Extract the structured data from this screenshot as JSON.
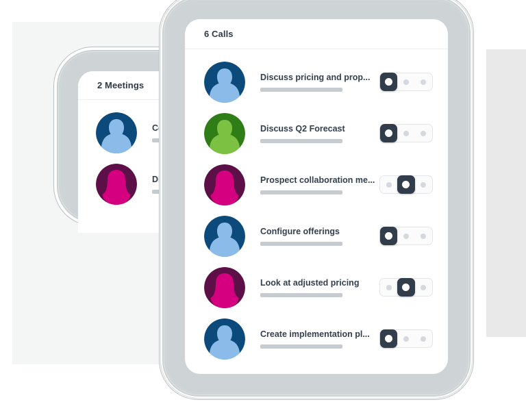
{
  "background": {
    "left_panel_color": "#f4f5f5",
    "right_panel_color": "#e9e9e9"
  },
  "back_card": {
    "header_title": "2 Meetings",
    "rows": [
      {
        "title": "Collabora",
        "avatar": "avatar-male-blue",
        "avatar_bg": "#0b4a7a",
        "avatar_fg": "#8bbbe8",
        "subtitle_placeholder": true
      },
      {
        "title": "Discuss",
        "avatar": "avatar-female-magenta",
        "avatar_bg": "#5d0f47",
        "avatar_fg": "#d4007f",
        "subtitle_placeholder": true
      }
    ]
  },
  "front_card": {
    "header_title": "6 Calls",
    "rows": [
      {
        "title": "Discuss pricing and prop...",
        "avatar": "avatar-male-blue",
        "avatar_bg": "#0b4a7a",
        "avatar_fg": "#8bbbe8",
        "toggle_position": 0,
        "toggle_positions": 3
      },
      {
        "title": "Discuss Q2 Forecast",
        "avatar": "avatar-male-green",
        "avatar_bg": "#2f7d16",
        "avatar_fg": "#7cc142",
        "toggle_position": 0,
        "toggle_positions": 3
      },
      {
        "title": "Prospect collaboration me...",
        "avatar": "avatar-female-magenta",
        "avatar_bg": "#5d0f47",
        "avatar_fg": "#d4007f",
        "toggle_position": 1,
        "toggle_positions": 3
      },
      {
        "title": "Configure offerings",
        "avatar": "avatar-male-blue",
        "avatar_bg": "#0b4a7a",
        "avatar_fg": "#8bbbe8",
        "toggle_position": 0,
        "toggle_positions": 3
      },
      {
        "title": "Look at adjusted pricing",
        "avatar": "avatar-female-magenta",
        "avatar_bg": "#5d0f47",
        "avatar_fg": "#d4007f",
        "toggle_position": 1,
        "toggle_positions": 3
      },
      {
        "title": "Create implementation pl...",
        "avatar": "avatar-male-blue",
        "avatar_bg": "#0b4a7a",
        "avatar_fg": "#8bbbe8",
        "toggle_position": 0,
        "toggle_positions": 3
      }
    ]
  },
  "colors": {
    "toggle_active": "#313d4a",
    "toggle_track": "#fbfbfc",
    "toggle_dot": "#d5d8dc",
    "title_text": "#33404e",
    "placeholder_bar": "#c6cbd0",
    "bezel": "#ced3d5"
  }
}
